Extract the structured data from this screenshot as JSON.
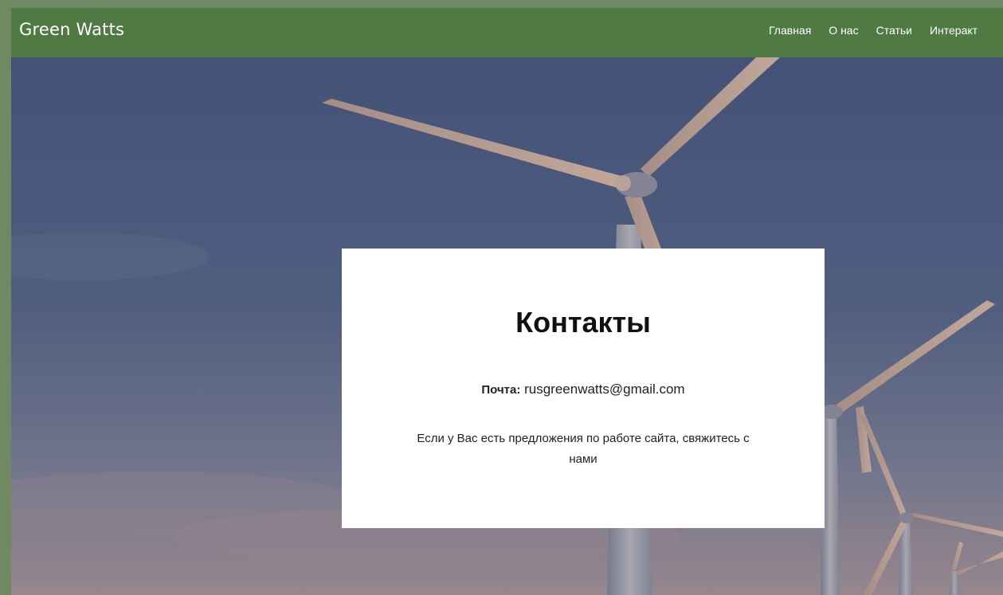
{
  "header": {
    "brand": "Green Watts",
    "nav": [
      {
        "label": "Главная"
      },
      {
        "label": "О нас"
      },
      {
        "label": "Статьи"
      },
      {
        "label": "Интеракт"
      }
    ]
  },
  "contact_card": {
    "title": "Контакты",
    "email_label": "Почта:",
    "email": "rusgreenwatts@gmail.com",
    "note": "Если у Вас есть предложения по работе сайта, свяжитесь с нами"
  },
  "colors": {
    "navbar": "#4f7a43",
    "frame": "#6f8a63",
    "card": "#ffffff"
  },
  "icons": {
    "hero": "wind-turbines-photo"
  }
}
